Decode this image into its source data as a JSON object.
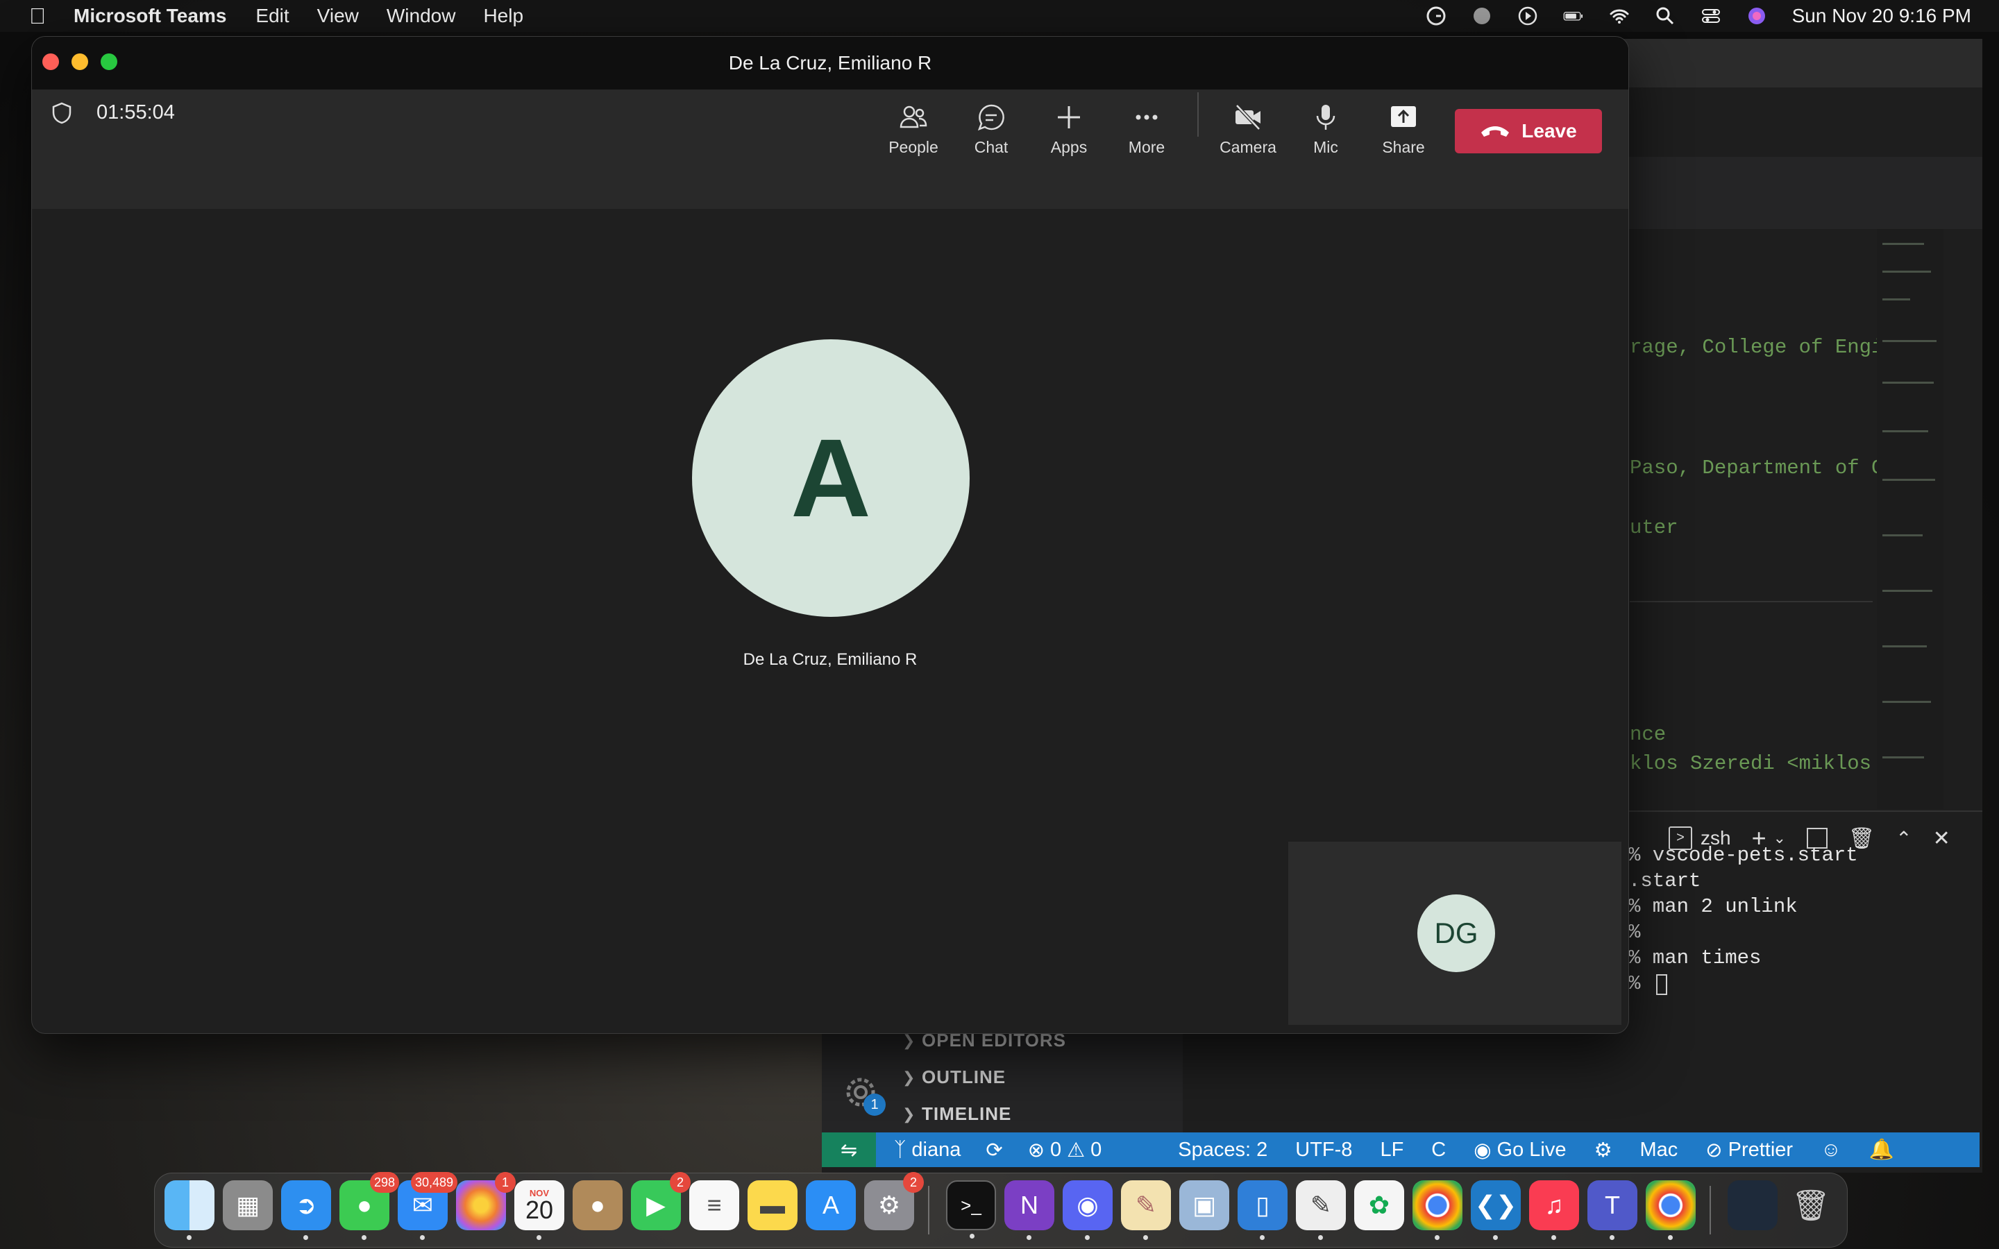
{
  "menubar": {
    "app_name": "Microsoft Teams",
    "items": [
      "Edit",
      "View",
      "Window",
      "Help"
    ],
    "datetime": "Sun Nov 20  9:16 PM"
  },
  "teams": {
    "window_title": "De La Cruz, Emiliano R",
    "call_timer": "01:55:04",
    "controls": {
      "people": "People",
      "chat": "Chat",
      "apps": "Apps",
      "more": "More",
      "camera": "Camera",
      "mic": "Mic",
      "share": "Share",
      "leave": "Leave"
    },
    "participant": {
      "initial": "A",
      "name": "De La Cruz, Emiliano R"
    },
    "self_view": {
      "initials": "DG"
    },
    "colors": {
      "leave": "#c4314b",
      "avatar_bg": "#d5e5dc",
      "avatar_fg": "#1c4533"
    }
  },
  "vscode": {
    "editor_lines": [
      "rage, College of Engi",
      "Paso, Department of C",
      "uter",
      "nce",
      "klos Szeredi <miklos"
    ],
    "terminal": {
      "shell": "zsh",
      "lines": [
        "% vscode-pets.start",
        ".start",
        "% man 2 unlink",
        "%",
        "% man times",
        "% "
      ]
    },
    "sidebar_sections": [
      "OPEN EDITORS",
      "OUTLINE",
      "TIMELINE"
    ],
    "settings_badge": "1",
    "statusbar": {
      "branch": "diana",
      "errors": "0",
      "warnings": "0",
      "spaces": "Spaces: 2",
      "encoding": "UTF-8",
      "eol": "LF",
      "language": "C",
      "go_live": "Go Live",
      "os": "Mac",
      "prettier": "Prettier"
    }
  },
  "dock": {
    "badges": {
      "messages": "298",
      "mail": "30,489",
      "photos": "1",
      "facetime": "2",
      "settings": "2"
    },
    "calendar_month": "NOV",
    "calendar_day": "20"
  }
}
